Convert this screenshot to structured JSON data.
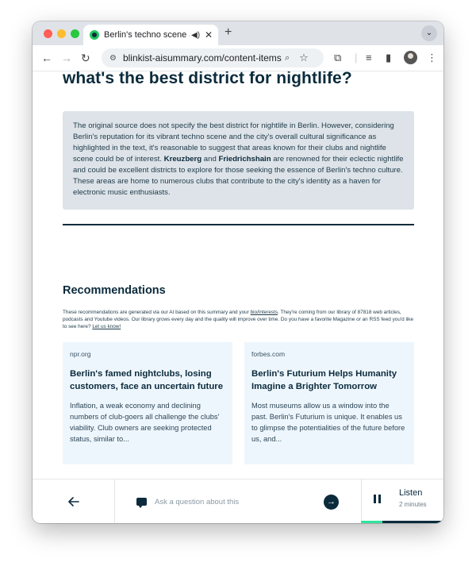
{
  "browser": {
    "tab_title": "Berlin's techno scene adc",
    "tab_close": "✕",
    "new_tab": "+",
    "tab_menu": "⌄",
    "url": "blinkist-aisummary.com/content-items/V...",
    "icons": [
      "back-icon",
      "forward-icon",
      "reload-icon",
      "site-info-icon",
      "zoom-icon",
      "star-icon",
      "extensions-icon",
      "media-icon",
      "sidepanel-icon",
      "profile-icon",
      "menu-icon"
    ]
  },
  "page": {
    "question": "what's the best district for nightlife?",
    "answer_part1": "The original source does not specify the best district for nightlife in Berlin. However, considering Berlin's reputation for its vibrant techno scene and the city's overall cultural significance as highlighted in the text, it's reasonable to suggest that areas known for their clubs and nightlife scene could be of interest. ",
    "answer_bold1": "Kreuzberg",
    "answer_and": " and ",
    "answer_bold2": "Friedrichshain",
    "answer_part2": " are renowned for their eclectic nightlife and could be excellent districts to explore for those seeking the essence of Berlin's techno culture. These areas are home to numerous clubs that contribute to the city's identity as a haven for electronic music enthusiasts."
  },
  "recommendations": {
    "title": "Recommendations",
    "note_part1": "These recommendations are generated via our AI based on this summary and your ",
    "note_link1": "bio/interests",
    "note_part2": ". They're coming from our library of 87818 web articles, podcasts and Youtube videos. Our library grows every day and the quality will improve over time. Do you have a favorite Magazine or an RSS feed you'd like to see here? ",
    "note_link2": "Let us know!",
    "cards": [
      {
        "source": "npr.org",
        "title": "Berlin's famed nightclubs, losing customers, face an uncertain future",
        "desc": "Inflation, a weak economy and declining numbers of club-goers all challenge the clubs' viability. Club owners are seeking protected status, similar to..."
      },
      {
        "source": "forbes.com",
        "title": "Berlin's Futurium Helps Humanity Imagine a Brighter Tomorrow",
        "desc": "Most museums allow us a window into the past. Berlin's Futurium is unique. It enables us to glimpse the potentialities of the future before us, and..."
      }
    ]
  },
  "bottom": {
    "ask_placeholder": "Ask a question about this",
    "listen_label": "Listen",
    "listen_duration": "2 minutes",
    "listen_progress": 0.26,
    "colors": {
      "accent": "#2ee59d",
      "navy": "#0b2b3c"
    }
  }
}
